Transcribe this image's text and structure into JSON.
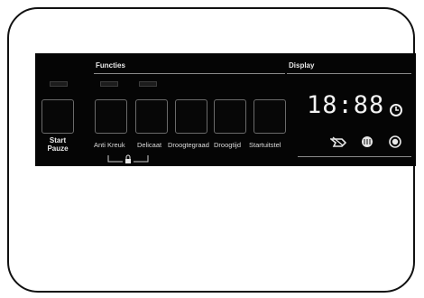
{
  "panel": {
    "functions_header": "Functies",
    "display_header": "Display",
    "start_button": {
      "line1": "Start",
      "line2": "Pauze"
    },
    "buttons": [
      {
        "label": "Anti Kreuk"
      },
      {
        "label": "Delicaat"
      },
      {
        "label": "Droogtegraad"
      },
      {
        "label": "Droogtijd"
      },
      {
        "label": "Startuitstel"
      }
    ],
    "display_value": "18:88",
    "icons": [
      "clock-icon",
      "dry-level-icon",
      "wrinkle-icon",
      "filter-icon"
    ]
  }
}
